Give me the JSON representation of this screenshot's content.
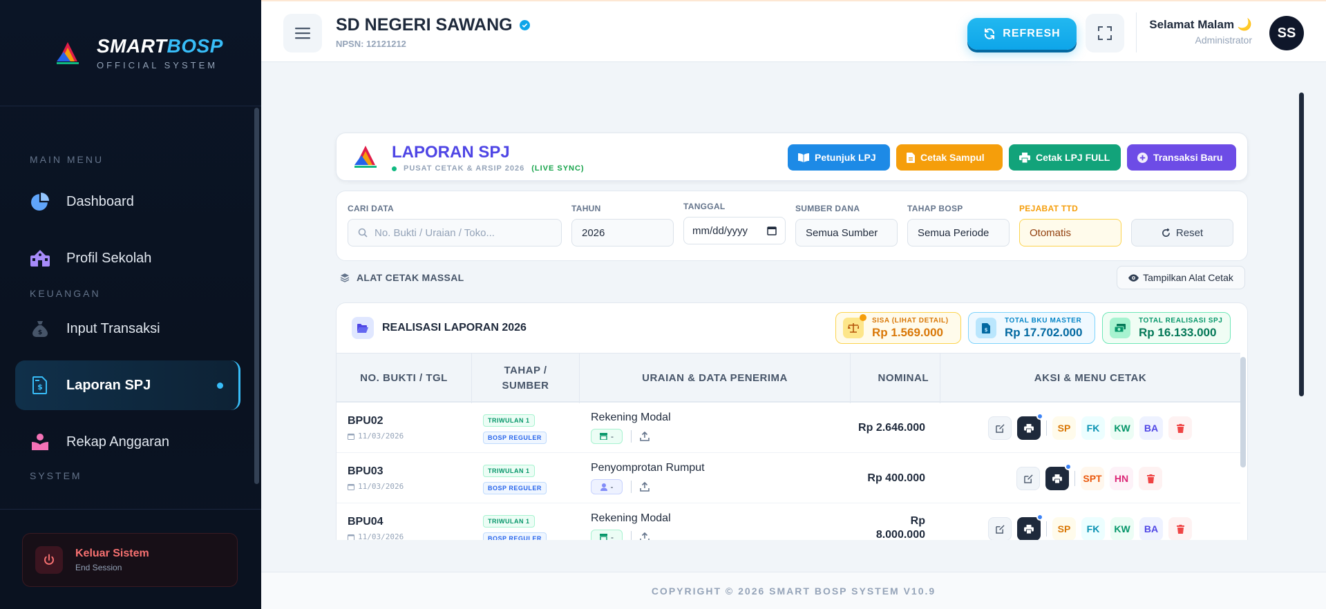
{
  "brand": {
    "name_a": "SMART",
    "name_b": "BOSP",
    "subtitle": "OFFICIAL SYSTEM"
  },
  "sidebar": {
    "sections": {
      "main": "MAIN MENU",
      "keuangan": "KEUANGAN",
      "system": "SYSTEM"
    },
    "items": [
      {
        "label": "Dashboard",
        "icon": "pie-chart-icon",
        "color": "#60a5fa"
      },
      {
        "label": "Profil Sekolah",
        "icon": "school-icon",
        "color": "#a78bfa"
      },
      {
        "label": "Input Transaksi",
        "icon": "money-bag-icon",
        "color": "#475569"
      },
      {
        "label": "Laporan SPJ",
        "icon": "file-invoice-icon",
        "color": "#38bdf8",
        "active": true
      },
      {
        "label": "Rekap Anggaran",
        "icon": "book-reader-icon",
        "color": "#f472b6"
      }
    ],
    "logout": {
      "title": "Keluar Sistem",
      "subtitle": "End Session"
    }
  },
  "header": {
    "school_name": "SD NEGERI SAWANG",
    "npsn": "NPSN: 12121212",
    "refresh_label": "REFRESH",
    "greeting": "Selamat Malam 🌙",
    "role": "Administrator",
    "avatar_initials": "SS"
  },
  "panel": {
    "title": "LAPORAN SPJ",
    "subtitle": "PUSAT CETAK & ARSIP 2026",
    "live": "(LIVE SYNC)",
    "actions": {
      "petunjuk": "Petunjuk LPJ",
      "sampul": "Cetak Sampul",
      "full": "Cetak LPJ FULL",
      "baru": "Transaksi Baru"
    }
  },
  "filters": {
    "cari": {
      "label": "CARI DATA",
      "placeholder": "No. Bukti / Uraian / Toko..."
    },
    "tahun": {
      "label": "TAHUN",
      "value": "2026"
    },
    "tanggal": {
      "label": "TANGGAL",
      "value": "mm/dd/yyyy"
    },
    "sumber": {
      "label": "SUMBER DANA",
      "value": "Semua Sumber"
    },
    "tahap": {
      "label": "TAHAP BOSP",
      "value": "Semua Periode"
    },
    "pejabat": {
      "label": "PEJABAT TTD",
      "value": "Otomatis"
    },
    "reset": "Reset"
  },
  "tools": {
    "label": "ALAT CETAK MASSAL",
    "toggle": "Tampilkan Alat Cetak"
  },
  "report": {
    "title": "REALISASI LAPORAN 2026",
    "stats": {
      "sisa": {
        "label": "SISA (LIHAT DETAIL)",
        "value": "Rp 1.569.000"
      },
      "bku": {
        "label": "TOTAL BKU MASTER",
        "value": "Rp 17.702.000"
      },
      "real": {
        "label": "TOTAL REALISASI SPJ",
        "value": "Rp 16.133.000"
      }
    },
    "columns": {
      "bukti": "NO. BUKTI / TGL",
      "tahap_a": "TAHAP /",
      "tahap_b": "SUMBER",
      "uraian": "URAIAN & DATA PENERIMA",
      "nominal": "NOMINAL",
      "aksi": "AKSI & MENU CETAK"
    },
    "rows": [
      {
        "bukti": "BPU02",
        "date": "11/03/2026",
        "tahap": "TRIWULAN 1",
        "sumber": "BOSP REGULER",
        "uraian": "Rekening Modal",
        "penerima": "-",
        "nominal": "Rp 2.646.000",
        "docs": [
          "SP",
          "FK",
          "KW",
          "BA"
        ]
      },
      {
        "bukti": "BPU03",
        "date": "11/03/2026",
        "tahap": "TRIWULAN 1",
        "sumber": "BOSP REGULER",
        "uraian": "Penyomprotan Rumput",
        "penerima": "-",
        "nominal": "Rp 400.000",
        "docs": [
          "SPT",
          "HN"
        ]
      },
      {
        "bukti": "BPU04",
        "date": "11/03/2026",
        "tahap": "TRIWULAN 1",
        "sumber": "BOSP REGULER",
        "uraian": "Rekening Modal",
        "penerima": "-",
        "nominal_a": "Rp",
        "nominal_b": "8.000.000",
        "docs": [
          "SP",
          "FK",
          "KW",
          "BA"
        ]
      }
    ]
  },
  "footer": "COPYRIGHT © 2026 SMART BOSP SYSTEM V10.9"
}
